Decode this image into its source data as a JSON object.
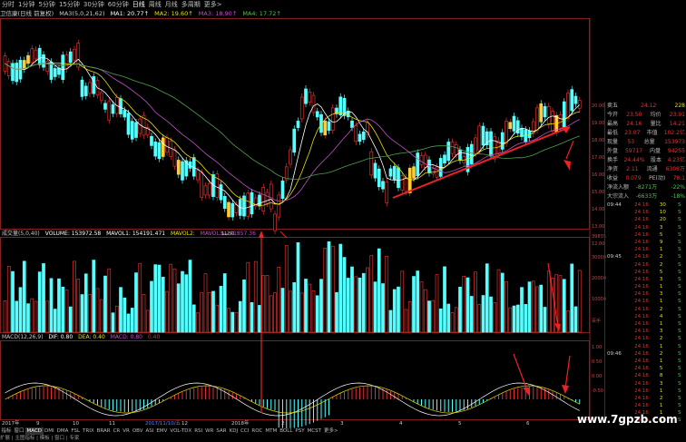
{
  "period_tabs": [
    "分时",
    "1分钟",
    "5分钟",
    "15分钟",
    "30分钟",
    "60分钟",
    "日线",
    "周线",
    "月线",
    "多周期",
    "更多>"
  ],
  "active_period": "日线",
  "main_header": {
    "name": "卫信康(日线 前复权)",
    "ma_params": "MA3(5,0,21,62)",
    "ma1": "MA1: 20.77↑",
    "ma2": "MA2: 19.60↑",
    "ma3": "MA3: 18.90↑",
    "ma4": "MA4: 17.72↑"
  },
  "price_axis": [
    "20.00",
    "19.00",
    "18.00",
    "17.00",
    "16.00",
    "15.00",
    "14.00",
    "13.00",
    "12.00"
  ],
  "low_label": "11.50",
  "vol_header": {
    "name": "成交量(5,0,40)",
    "volume": "VOLUME: 153972.58",
    "mavol1": "MAVOL1: 154191.471",
    "mavol2": "MAVOL2:",
    "mavol3": "MAVOL3: 141857.36"
  },
  "vol_axis": [
    "39835",
    "30000",
    "20000",
    "10000",
    "百手"
  ],
  "macd_header": {
    "name": "MACD(12,26,9)",
    "dif": "DIF: 0.80",
    "dea": "DEA: 0.40",
    "macd": "MACD: 0.80",
    "extra": "0.40"
  },
  "macd_axis": [
    "1.00",
    "0.50",
    "0.00",
    "-0.50"
  ],
  "time_labels": [
    "2017年",
    "9",
    "10",
    "11",
    "2017/11/10/五",
    "12",
    "2018年",
    "2",
    "3",
    "4",
    "5",
    "6"
  ],
  "quote": {
    "title_left": "卖五",
    "title_val": "24.12",
    "title_right": "228",
    "rows": [
      {
        "k": "今开",
        "v": "23.50",
        "k2": "均价",
        "v2": "23.91"
      },
      {
        "k": "最高",
        "v": "24.16",
        "k2": "量比",
        "v2": "14.21"
      },
      {
        "k": "最低",
        "v": "23.07",
        "k2": "市值",
        "v2": "102.2亿"
      },
      {
        "k": "现量",
        "v": "53",
        "k2": "总量",
        "v2": "153973"
      },
      {
        "k": "外盘",
        "v": "59717",
        "k2": "内盘",
        "v2": "94255"
      },
      {
        "k": "换手",
        "v": "24.44%",
        "k2": "股本",
        "v2": "4.23亿"
      },
      {
        "k": "净资",
        "v": "2.11",
        "k2": "流通",
        "v2": "6308万"
      },
      {
        "k": "收益",
        "v": "0.079",
        "k2": "PE(动)",
        "v2": "78.1"
      },
      {
        "k": "净流入额",
        "v": "-8271万",
        "k2": "",
        "v2": "-22%"
      },
      {
        "k": "大宗流入",
        "v": "-6633万",
        "k2": "",
        "v2": "-18%"
      }
    ]
  },
  "ticks": [
    {
      "t": "09:44",
      "p": "24.16",
      "v": "30",
      "s": "S"
    },
    {
      "t": "",
      "p": "24.16",
      "v": "10",
      "s": "S"
    },
    {
      "t": "",
      "p": "24.16",
      "v": "20",
      "s": "S"
    },
    {
      "t": "",
      "p": "24.16",
      "v": "3",
      "s": "S"
    },
    {
      "t": "",
      "p": "24.16",
      "v": "5",
      "s": "S"
    },
    {
      "t": "",
      "p": "24.16",
      "v": "9",
      "s": "S"
    },
    {
      "t": "",
      "p": "24.16",
      "v": "1",
      "s": "S"
    },
    {
      "t": "09:45",
      "p": "24.16",
      "v": "2",
      "s": "S"
    },
    {
      "t": "",
      "p": "24.16",
      "v": "2",
      "s": "S"
    },
    {
      "t": "",
      "p": "24.16",
      "v": "5",
      "s": "S"
    },
    {
      "t": "",
      "p": "24.16",
      "v": "3",
      "s": "S"
    },
    {
      "t": "",
      "p": "24.16",
      "v": "1",
      "s": "S"
    },
    {
      "t": "",
      "p": "24.16",
      "v": "3",
      "s": "S"
    },
    {
      "t": "",
      "p": "24.16",
      "v": "1",
      "s": "S"
    },
    {
      "t": "",
      "p": "24.16",
      "v": "2",
      "s": "S"
    },
    {
      "t": "",
      "p": "24.16",
      "v": "4",
      "s": "S"
    },
    {
      "t": "",
      "p": "24.16",
      "v": "1",
      "s": "S"
    },
    {
      "t": "",
      "p": "24.16",
      "v": "3",
      "s": "S"
    },
    {
      "t": "",
      "p": "24.16",
      "v": "2",
      "s": "S"
    },
    {
      "t": "",
      "p": "24.16",
      "v": "1",
      "s": "S"
    },
    {
      "t": "09:46",
      "p": "24.16",
      "v": "2",
      "s": "S"
    },
    {
      "t": "",
      "p": "24.16",
      "v": "1",
      "s": "S"
    },
    {
      "t": "",
      "p": "24.16",
      "v": "5",
      "s": "S"
    },
    {
      "t": "",
      "p": "24.16",
      "v": "8",
      "s": "S"
    },
    {
      "t": "",
      "p": "24.16",
      "v": "3",
      "s": "S"
    },
    {
      "t": "",
      "p": "24.16",
      "v": "1",
      "s": "S"
    },
    {
      "t": "",
      "p": "24.16",
      "v": "2",
      "s": "S"
    },
    {
      "t": "",
      "p": "24.16",
      "v": "1",
      "s": "S"
    },
    {
      "t": "",
      "p": "24.16",
      "v": "1",
      "s": "S"
    },
    {
      "t": "",
      "p": "24.16",
      "v": "1",
      "s": "S"
    }
  ],
  "indicator_tabs": [
    "指标",
    "窗口",
    "MACD",
    "DMI",
    "DMA",
    "FSL",
    "TRIX",
    "BRAR",
    "CR",
    "VR",
    "OBV",
    "ASI",
    "EMV",
    "VOL-TDX",
    "RSI",
    "WR",
    "SAR",
    "KDJ",
    "CCI",
    "ROC",
    "MTM",
    "BOLL",
    "PSY",
    "MCST",
    "更多>"
  ],
  "active_indicator": "MACD",
  "status": "扩展 | 主图指标 | 模板 | 窗口 | 专家",
  "watermark": "www.7gpzb.com",
  "colors": {
    "up": "#e03030",
    "down": "#54ffff",
    "accent": "#ffcc33",
    "ma_white": "#ffffff",
    "ma_yellow": "#e8e000",
    "ma_purple": "#c050c0",
    "ma_green": "#50a050"
  }
}
